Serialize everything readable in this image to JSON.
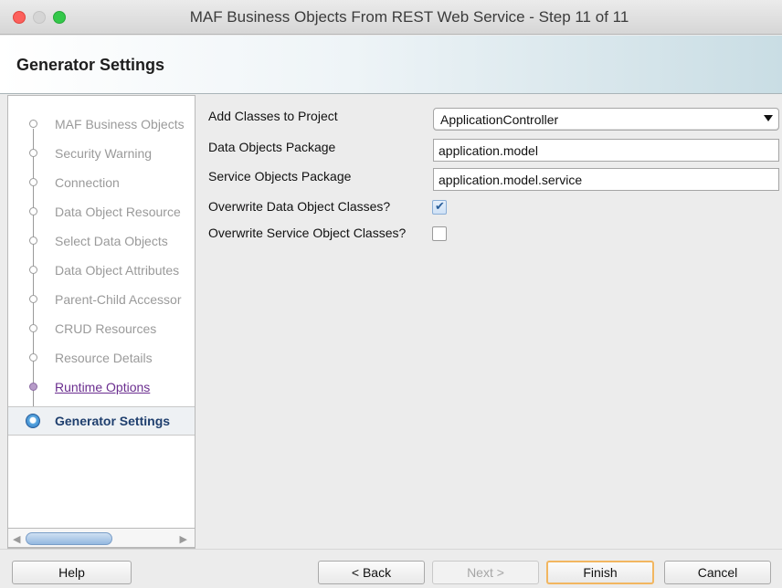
{
  "window": {
    "title": "MAF Business Objects From REST Web Service - Step 11 of 11"
  },
  "header": {
    "title": "Generator Settings"
  },
  "steps": [
    {
      "label": "MAF Business Objects",
      "state": "pending"
    },
    {
      "label": "Security Warning",
      "state": "pending"
    },
    {
      "label": "Connection",
      "state": "pending"
    },
    {
      "label": "Data Object Resource",
      "state": "pending"
    },
    {
      "label": "Select Data Objects",
      "state": "pending"
    },
    {
      "label": "Data Object Attributes",
      "state": "pending"
    },
    {
      "label": "Parent-Child Accessor",
      "state": "pending"
    },
    {
      "label": "CRUD Resources",
      "state": "pending"
    },
    {
      "label": "Resource Details",
      "state": "pending"
    },
    {
      "label": "Runtime Options",
      "state": "visited"
    },
    {
      "label": "Generator Settings",
      "state": "current"
    }
  ],
  "form": {
    "add_classes_label": "Add Classes to Project",
    "add_classes_value": "ApplicationController",
    "data_objects_label": "Data Objects Package",
    "data_objects_value": "application.model",
    "service_objects_label": "Service Objects Package",
    "service_objects_value": "application.model.service",
    "overwrite_data_label": "Overwrite Data Object Classes?",
    "overwrite_data_checked": true,
    "overwrite_service_label": "Overwrite Service Object Classes?",
    "overwrite_service_checked": false
  },
  "buttons": {
    "help": "Help",
    "back": "< Back",
    "next": "Next >",
    "finish": "Finish",
    "cancel": "Cancel"
  },
  "colors": {
    "visited_step": "#6b2e8f",
    "current_step": "#1f3f6e",
    "default_button_border": "#f2b660"
  }
}
